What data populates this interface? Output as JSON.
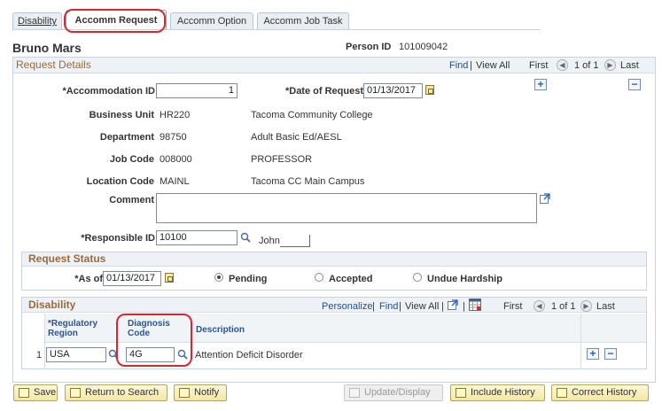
{
  "tabs": [
    {
      "label": "Disability"
    },
    {
      "label": "Accomm Request"
    },
    {
      "label": "Accomm Option"
    },
    {
      "label": "Accomm Job Task"
    }
  ],
  "person": {
    "name": "Bruno Mars",
    "id_label": "Person ID",
    "id_value": "101009042"
  },
  "request_details": {
    "title": "Request Details",
    "nav": {
      "find": "Find",
      "view_all": "View All",
      "first": "First",
      "range": "1 of 1",
      "last": "Last"
    },
    "accommodation_id_label": "*Accommodation ID",
    "accommodation_id_value": "1",
    "date_of_request_label": "*Date of Request",
    "date_of_request_value": "01/13/2017",
    "business_unit_label": "Business Unit",
    "business_unit_code": "HR220",
    "business_unit_desc": "Tacoma Community College",
    "department_label": "Department",
    "department_code": "98750",
    "department_desc": "Adult Basic Ed/AESL",
    "job_code_label": "Job Code",
    "job_code_code": "008000",
    "job_code_desc": "PROFESSOR",
    "location_code_label": "Location Code",
    "location_code_code": "MAINL",
    "location_code_desc": "Tacoma CC Main Campus",
    "comment_label": "Comment",
    "comment_value": "",
    "responsible_id_label": "*Responsible ID",
    "responsible_id_value": "10100",
    "responsible_name": "John"
  },
  "request_status": {
    "title": "Request Status",
    "as_of_label": "*As of",
    "as_of_value": "01/13/2017",
    "options": [
      {
        "label": "Pending",
        "selected": true
      },
      {
        "label": "Accepted",
        "selected": false
      },
      {
        "label": "Undue Hardship",
        "selected": false
      }
    ]
  },
  "disability": {
    "title": "Disability",
    "nav": {
      "personalize": "Personalize",
      "find": "Find",
      "view_all": "View All",
      "first": "First",
      "range": "1 of 1",
      "last": "Last"
    },
    "columns": {
      "region_line1": "*Regulatory",
      "region_line2": "Region",
      "diag_line1": "Diagnosis",
      "diag_line2": "Code",
      "description": "Description"
    },
    "rows": [
      {
        "num": "1",
        "region": "USA",
        "diagnosis_code": "4G",
        "description": "Attention Deficit Disorder"
      }
    ]
  },
  "toolbar": {
    "save": "Save",
    "return_to_search": "Return to Search",
    "notify": "Notify",
    "update_display": "Update/Display",
    "include_history": "Include History",
    "correct_history": "Correct History"
  },
  "colors": {
    "highlight": "#d7282f",
    "section_title": "#9a6a3a",
    "link": "#1f4e96"
  }
}
